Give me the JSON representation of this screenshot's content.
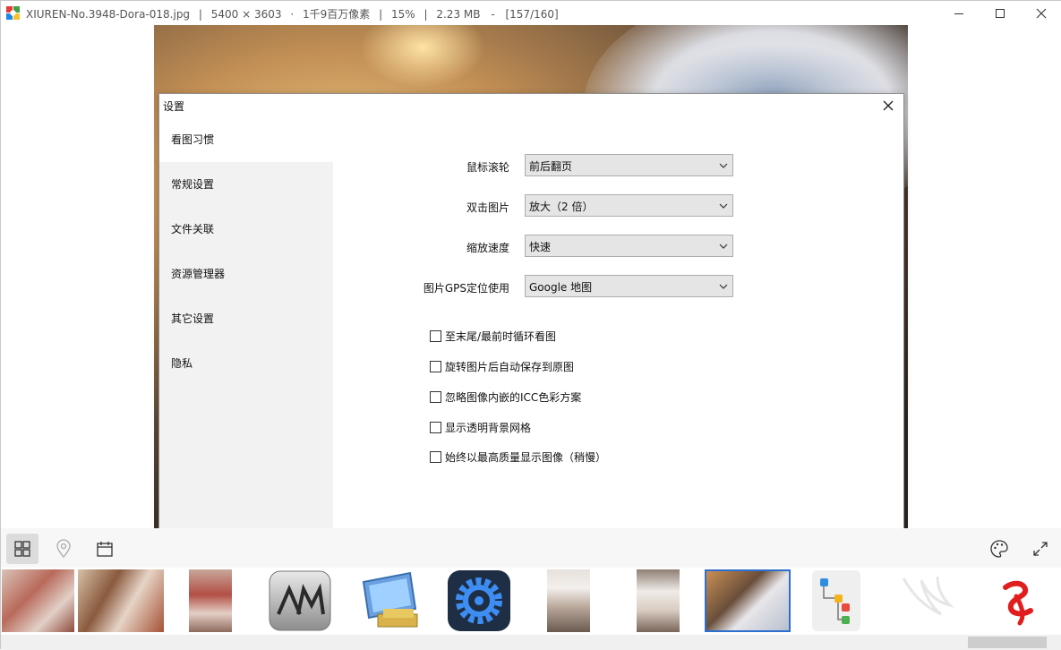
{
  "titlebar": {
    "filename": "XIUREN-No.3948-Dora-018.jpg",
    "separator": "|",
    "dimensions": "5400 × 3603",
    "dot": "·",
    "megapixels": "1千9百万像素",
    "zoom": "15%",
    "filesize": "2.23 MB",
    "dash": "-",
    "position": "[157/160]"
  },
  "dialog": {
    "title": "设置",
    "nav": [
      {
        "label": "看图习惯"
      },
      {
        "label": "常规设置"
      },
      {
        "label": "文件关联"
      },
      {
        "label": "资源管理器"
      },
      {
        "label": "其它设置"
      },
      {
        "label": "隐私"
      }
    ],
    "fields": [
      {
        "label": "鼠标滚轮",
        "value": "前后翻页"
      },
      {
        "label": "双击图片",
        "value": "放大（2 倍）"
      },
      {
        "label": "缩放速度",
        "value": "快速"
      },
      {
        "label": "图片GPS定位使用",
        "value": "Google 地图"
      }
    ],
    "checkboxes": [
      {
        "label": "至末尾/最前时循环看图",
        "checked": false
      },
      {
        "label": "旋转图片后自动保存到原图",
        "checked": false
      },
      {
        "label": "忽略图像内嵌的ICC色彩方案",
        "checked": false
      },
      {
        "label": "显示透明背景网格",
        "checked": false
      },
      {
        "label": "始终以最高质量显示图像（稍慢）",
        "checked": false
      }
    ]
  },
  "toolbar": {
    "left": [
      "grid-icon",
      "location-pin-icon",
      "calendar-icon"
    ],
    "right": [
      "palette-icon",
      "fullscreen-icon"
    ]
  },
  "filmstrip": {
    "items": [
      {
        "name": "photo-thumb",
        "selected": false
      },
      {
        "name": "photo-thumb",
        "selected": false
      },
      {
        "name": "photo-thumb",
        "selected": false
      },
      {
        "name": "am-app-thumb",
        "selected": false
      },
      {
        "name": "monitor-app-thumb",
        "selected": false
      },
      {
        "name": "gear-app-thumb",
        "selected": false
      },
      {
        "name": "photo-thumb",
        "selected": false
      },
      {
        "name": "photo-thumb",
        "selected": false
      },
      {
        "name": "photo-thumb",
        "selected": true
      },
      {
        "name": "tree-diagram-thumb",
        "selected": false
      },
      {
        "name": "bird-logo-thumb",
        "selected": false
      },
      {
        "name": "red-logo-thumb",
        "selected": false
      }
    ]
  }
}
